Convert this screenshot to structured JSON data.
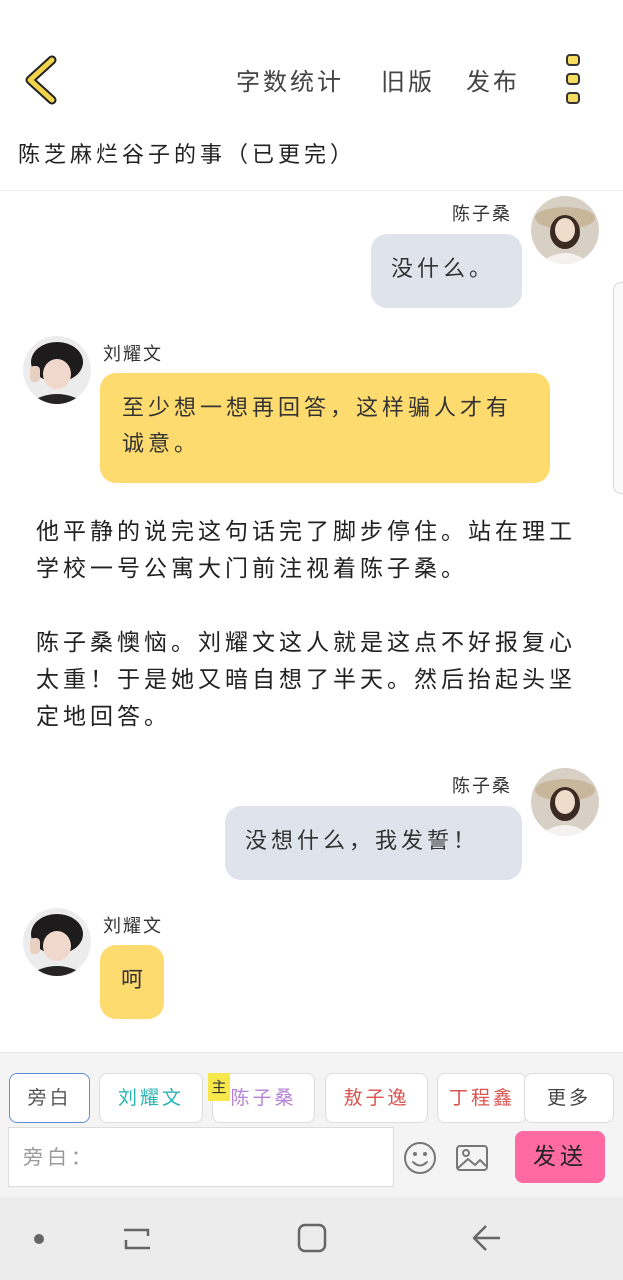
{
  "header": {
    "word_count_label": "字数统计",
    "old_version_label": "旧版",
    "publish_label": "发布",
    "story_title": "陈芝麻烂谷子的事（已更完）"
  },
  "messages": [
    {
      "type": "right",
      "name": "陈子桑",
      "text": "没什么。"
    },
    {
      "type": "left",
      "name": "刘耀文",
      "text": "至少想一想再回答，这样骗人才有诚意。"
    },
    {
      "type": "narration",
      "text": "他平静的说完这句话完了脚步停住。站在理工学校一号公寓大门前注视着陈子桑。"
    },
    {
      "type": "narration",
      "text": "陈子桑懊恼。刘耀文这人就是这点不好报复心太重！于是她又暗自想了半天。然后抬起头坚定地回答。"
    },
    {
      "type": "right",
      "name": "陈子桑",
      "text": "没想什么，我发誓！"
    },
    {
      "type": "left",
      "name": "刘耀文",
      "text": "呵"
    }
  ],
  "character_tabs": [
    "旁白",
    "刘耀文",
    "陈子桑",
    "敖子逸",
    "丁程鑫",
    "更多"
  ],
  "main_badge": "主",
  "input": {
    "placeholder": "旁白："
  },
  "send_label": "发送",
  "colors": {
    "bubble_left": "#fedb6e",
    "bubble_right": "#dfe3ec",
    "send_button": "#ff6aa2",
    "tab_liu": "#2bb5b5",
    "tab_chen": "#b483d6",
    "tab_ao": "#d9534f",
    "tab_ding": "#d9534f",
    "selected_tab_border": "#5d8fd6",
    "back_arrow": "#f3d34a"
  }
}
